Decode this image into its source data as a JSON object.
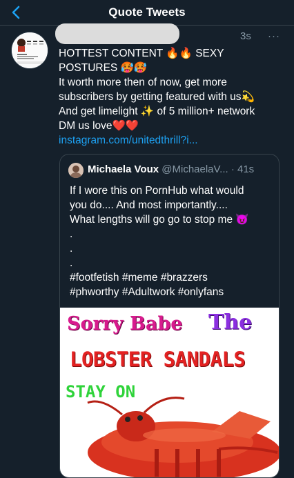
{
  "header": {
    "title": "Quote Tweets"
  },
  "tweet": {
    "time": "3s",
    "more_label": "···",
    "text_lines": [
      "HOTTEST CONTENT 🔥🔥 SEXY",
      "POSTURES 🥵🥵",
      "It worth more then of now, get more",
      "subscribers by getting featured with us💫",
      "And get limelight ✨ of 5 million+ network",
      "DM us love❤️❤️"
    ],
    "link": "instagram.com/unitedthrill?i..."
  },
  "quoted": {
    "name": "Michaela Voux",
    "handle": "@MichaelaV...",
    "time": "· 41s",
    "text_lines": [
      "If I wore this on PornHub what would",
      "you do.... And most importantly....",
      "What lengths will go go to stop me 😈",
      ".",
      ".",
      ".",
      "#footfetish #meme #brazzers",
      "#phworthy #Adultwork #onlyfans"
    ],
    "media": {
      "line1": "Sorry Babe",
      "line1b": "The",
      "line2": "LOBSTER SANDALS",
      "line3": "STAY ON"
    }
  },
  "colors": {
    "background": "#15202b",
    "accent": "#1da1f2",
    "muted": "#8899a6",
    "border": "#38444d"
  }
}
